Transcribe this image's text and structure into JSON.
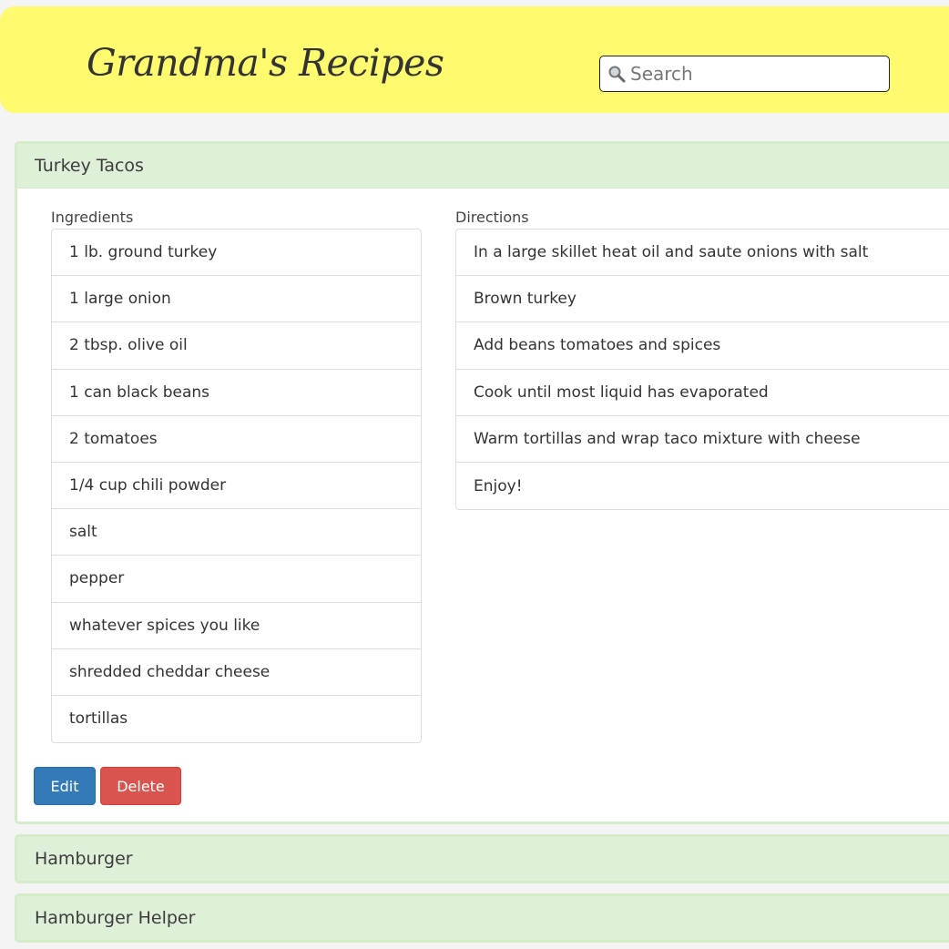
{
  "header": {
    "title": "Grandma's Recipes",
    "search_placeholder": "Search"
  },
  "recipes": [
    {
      "name": "Turkey Tacos",
      "expanded": true,
      "ingredients_label": "Ingredients",
      "directions_label": "Directions",
      "ingredients": [
        "1 lb. ground turkey",
        "1 large onion",
        "2 tbsp. olive oil",
        "1 can black beans",
        "2 tomatoes",
        "1/4 cup chili powder",
        "salt",
        "pepper",
        "whatever spices you like",
        "shredded cheddar cheese",
        "tortillas"
      ],
      "directions": [
        "In a large skillet heat oil and saute onions with salt",
        "Brown turkey",
        "Add beans tomatoes and spices",
        "Cook until most liquid has evaporated",
        "Warm tortillas and wrap taco mixture with cheese",
        "Enjoy!"
      ],
      "edit_label": "Edit",
      "delete_label": "Delete"
    },
    {
      "name": "Hamburger",
      "expanded": false
    },
    {
      "name": "Hamburger Helper",
      "expanded": false
    }
  ],
  "colors": {
    "header_bg": "#fffa6e",
    "panel_heading_bg": "#dff0d8",
    "edit_button": "#337ab7",
    "delete_button": "#d9534f"
  },
  "icons": {
    "search": "magnifier-icon"
  }
}
